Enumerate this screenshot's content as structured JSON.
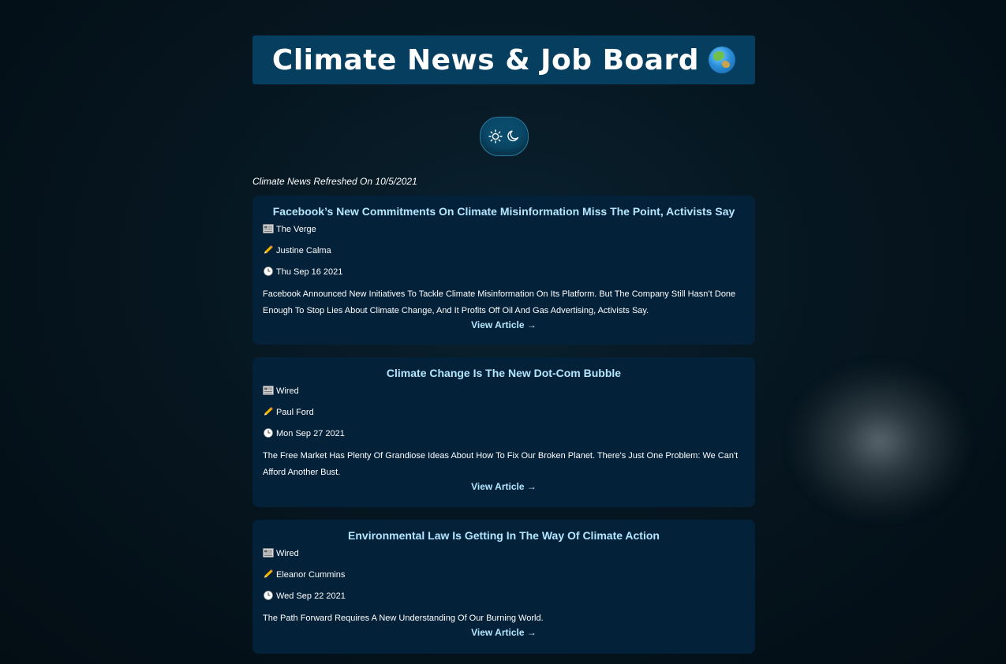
{
  "header": {
    "title": "Climate News & Job Board"
  },
  "theme_toggle": {
    "icons": [
      "sun-icon",
      "moon-icon"
    ]
  },
  "refreshed_text": "Climate News Refreshed On 10/5/2021",
  "articles": [
    {
      "title": "Facebook’s New Commitments On Climate Misinformation Miss The Point, Activists Say",
      "source": "The Verge",
      "author": "Justine Calma",
      "date": "Thu Sep 16 2021",
      "description": "Facebook Announced New Initiatives To Tackle Climate Misinformation On Its Platform. But The Company Still Hasn’t Done Enough To Stop Lies About Climate Change, And It Profits Off Oil And Gas Advertising, Activists Say.",
      "link_label": "View Article →"
    },
    {
      "title": "Climate Change Is The New Dot-Com Bubble",
      "source": "Wired",
      "author": "Paul Ford",
      "date": "Mon Sep 27 2021",
      "description": "The Free Market Has Plenty Of Grandiose Ideas About How To Fix Our Broken Planet. There's Just One Problem: We Can't Afford Another Bust.",
      "link_label": "View Article →"
    },
    {
      "title": "Environmental Law Is Getting In The Way Of Climate Action",
      "source": "Wired",
      "author": "Eleanor Cummins",
      "date": "Wed Sep 22 2021",
      "description": "The Path Forward Requires A New Understanding Of Our Burning World.",
      "link_label": "View Article →"
    }
  ],
  "colors": {
    "background": "#061620",
    "title_bar": "#053e5e",
    "card": "#03223a",
    "accent_text": "#b5e6ff"
  }
}
